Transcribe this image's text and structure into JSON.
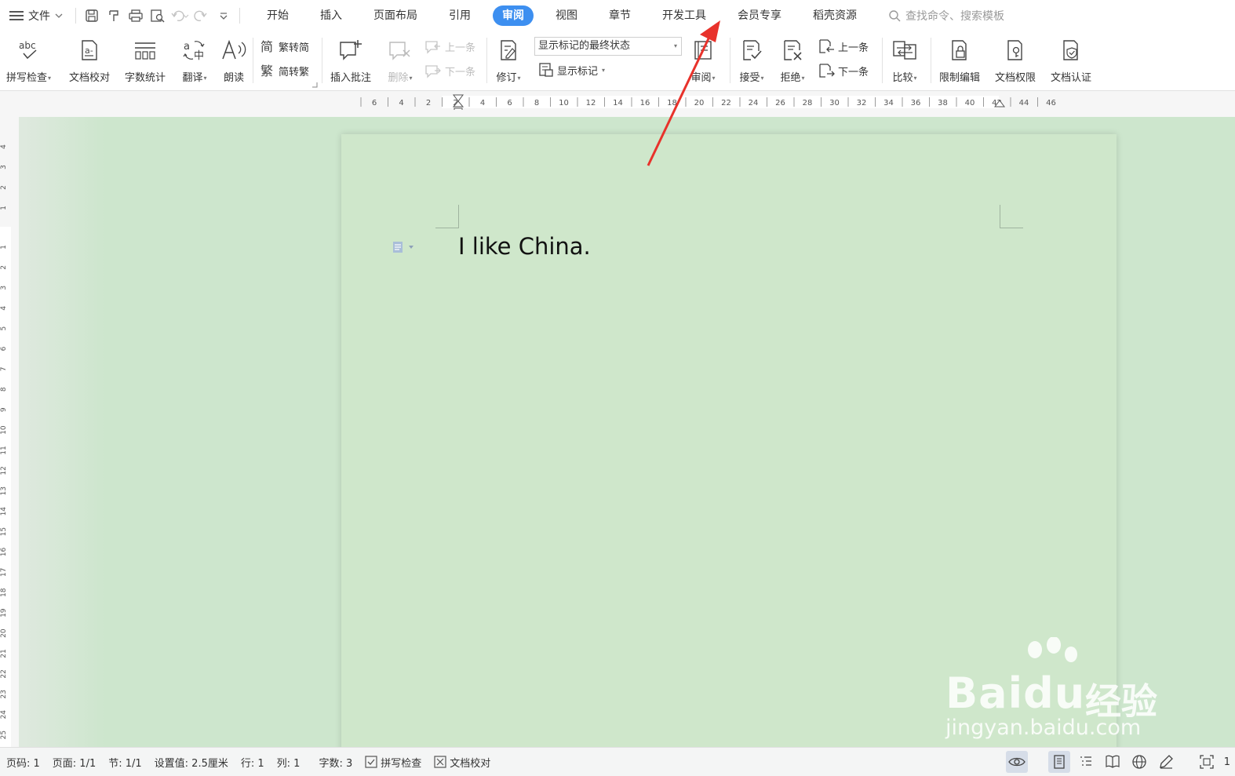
{
  "tabbar": {
    "file_label": "文件",
    "tabs": [
      "开始",
      "插入",
      "页面布局",
      "引用",
      "审阅",
      "视图",
      "章节",
      "开发工具",
      "会员专享",
      "稻壳资源"
    ],
    "active_tab": "审阅",
    "search_placeholder": "查找命令、搜索模板"
  },
  "ribbon": {
    "spell_check": "拼写检查",
    "doc_proof": "文档校对",
    "word_count": "字数统计",
    "translate": "翻译",
    "read_aloud": "朗读",
    "trad_to_simp": "繁转简",
    "simp_to_trad": "简转繁",
    "insert_comment": "插入批注",
    "delete": "删除",
    "prev_comment": "上一条",
    "next_comment": "下一条",
    "revise": "修订",
    "markup_state": "显示标记的最终状态",
    "show_markup": "显示标记",
    "review_pane": "审阅",
    "accept": "接受",
    "reject": "拒绝",
    "prev_change": "上一条",
    "next_change": "下一条",
    "compare": "比较",
    "restrict_edit": "限制编辑",
    "doc_permission": "文档权限",
    "doc_certify": "文档认证"
  },
  "ruler": {
    "h_ticks": [
      "6",
      "4",
      "2",
      "2",
      "4",
      "6",
      "8",
      "10",
      "12",
      "14",
      "16",
      "18",
      "20",
      "22",
      "24",
      "26",
      "28",
      "30",
      "32",
      "34",
      "36",
      "38",
      "40",
      "42",
      "44",
      "46"
    ],
    "v_ticks_top": [
      "4",
      "3",
      "2",
      "1"
    ],
    "v_ticks": [
      "1",
      "2",
      "3",
      "4",
      "5",
      "6",
      "7",
      "8",
      "9",
      "10",
      "11",
      "12",
      "13",
      "14",
      "15",
      "16",
      "17",
      "18",
      "19",
      "20",
      "21",
      "22",
      "23",
      "24",
      "25"
    ]
  },
  "document": {
    "text": "I like China."
  },
  "watermark": {
    "brand": "Bai",
    "brand2": "du",
    "cn": "经验",
    "url": "jingyan.baidu.com"
  },
  "statusbar": {
    "page_code": "页码: 1",
    "page": "页面: 1/1",
    "section": "节: 1/1",
    "setting": "设置值: 2.5厘米",
    "line": "行: 1",
    "column": "列: 1",
    "word_count": "字数: 3",
    "spell_check": "拼写检查",
    "doc_proof": "文档校对",
    "zoom_partial": "1"
  },
  "colors": {
    "accent": "#3d8ff0",
    "page_bg": "#cfe7cb",
    "workspace_bg": "#cde6cd",
    "arrow": "#e8322b"
  }
}
